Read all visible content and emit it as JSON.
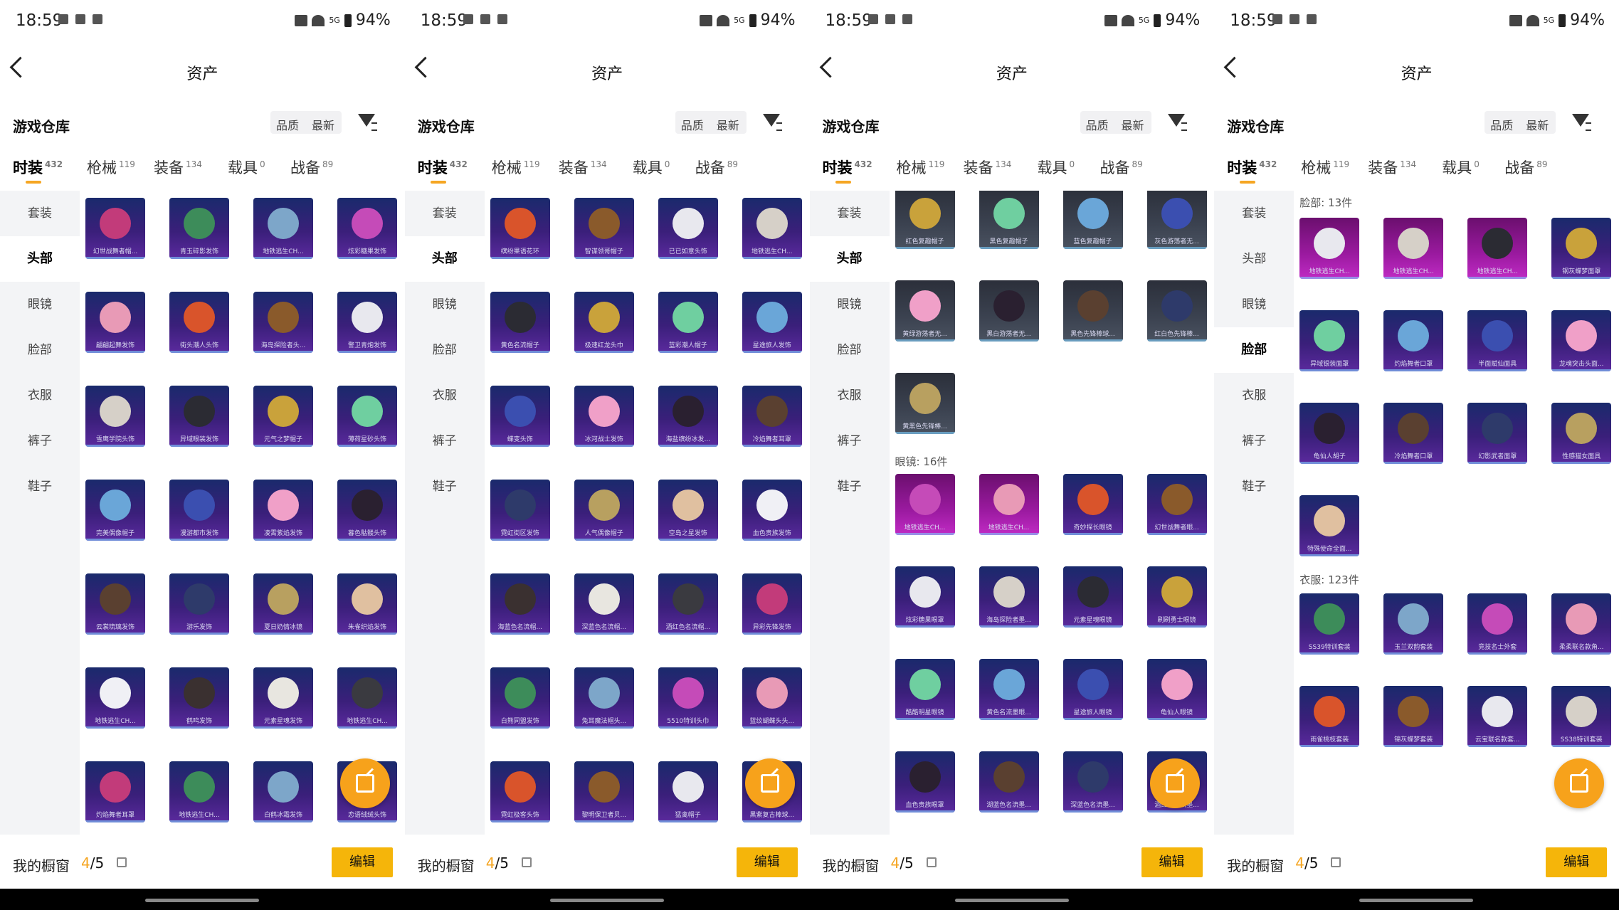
{
  "status": {
    "time": "18:59",
    "battery": "94%",
    "net": "5G"
  },
  "title": "资产",
  "warehouse": {
    "title": "游戏仓库",
    "sort_quality": "品质",
    "sort_latest": "最新"
  },
  "tabs": [
    {
      "label": "时装",
      "count": "432"
    },
    {
      "label": "枪械",
      "count": "119"
    },
    {
      "label": "装备",
      "count": "134"
    },
    {
      "label": "载具",
      "count": "0"
    },
    {
      "label": "战备",
      "count": "89"
    }
  ],
  "sidebar": [
    "套装",
    "头部",
    "眼镜",
    "脸部",
    "衣服",
    "裤子",
    "鞋子"
  ],
  "sections": {
    "face": "脸部: 13件",
    "glasses": "眼镜: 16件",
    "clothes": "衣服: 123件"
  },
  "bottom": {
    "label": "我的橱窗",
    "count": "4",
    "total": "/5",
    "edit": "编辑"
  },
  "screens": [
    {
      "active_sidebar": 1,
      "items": [
        "幻世战舞者帽...",
        "青玉碎影发饰",
        "地铁逃生CH...",
        "炫彩糖果发饰",
        "翩翩起舞发饰",
        "街头潮人头饰",
        "海岛探险者头...",
        "警卫青炮发饰",
        "雪鹰学院头饰",
        "异域眼装发饰",
        "元气之梦帽子",
        "薄荷星砂头饰",
        "完美偶像帽子",
        "漫游都市发饰",
        "凌霄紫焰发饰",
        "暮色骷髅头饰",
        "云裳琉璃发饰",
        "游乐发饰",
        "夏日奶情冰镜",
        "朱雀织焰发饰",
        "地铁逃生CH...",
        "鹤鸣发饰",
        "元素星魂发饰",
        "地铁逃生CH...",
        "灼焰舞者耳罩",
        "地铁逃生CH...",
        "白鹤冰霜发饰",
        "恋语绒绒头饰"
      ]
    },
    {
      "active_sidebar": 1,
      "items": [
        "缤纷果语花环",
        "智谋领哥帽子",
        "已已如意头饰",
        "地铁逃生CH...",
        "黄色名流帽子",
        "极速红龙头巾",
        "蓝彩潮人帽子",
        "星途旅人发饰",
        "蝶变头饰",
        "冰河战士发饰",
        "海盐缤纷冰发...",
        "冷焰舞者耳罩",
        "霓虹街区发饰",
        "人气偶像帽子",
        "空岛之星发饰",
        "血色贵族发饰",
        "海蓝色名流帽...",
        "深蓝色名流帽...",
        "酒红色名流帽...",
        "异彩先锋发饰",
        "白熊同盟发饰",
        "兔耳魔法帽头...",
        "5510特训头巾",
        "蓝纹蝴蝶头头...",
        "霓虹极客头饰",
        "黎明保卫者贝...",
        "猛禽帽子",
        "黑紫复古棒球..."
      ]
    },
    {
      "active_sidebar": 1,
      "items": [
        "红色复趣帽子",
        "黑色复趣帽子",
        "蓝色复趣帽子",
        "灰色游荡者无...",
        "黄绿游荡者无...",
        "黑白游荡者无...",
        "黑色先锋棒球...",
        "红白色先锋棒...",
        "黄黑色先锋棒..."
      ],
      "glasses": [
        "地铁逃生CH...",
        "地铁逃生CH...",
        "奇妙探长眼镜",
        "幻世战舞者眼...",
        "炫彩糖果眼罩",
        "海岛探险者墨...",
        "元素星魂眼镜",
        "刷刷勇士眼镜",
        "酷酷明星眼镜",
        "黄色名流墨眼...",
        "星途旅人眼镜",
        "龟仙人眼镜",
        "血色贵族眼罩",
        "湖蓝色名流墨...",
        "深蓝色名流墨...",
        "酒红色名流墨..."
      ]
    },
    {
      "active_sidebar": 3,
      "face": [
        "地铁逃生CH...",
        "地铁逃生CH...",
        "地铁逃生CH...",
        "钢灰蝶梦面罩",
        "异域银装面罩",
        "灼焰舞者口罩",
        "半面赋仙面具",
        "龙魂突击头面...",
        "龟仙人胡子",
        "冷焰舞者口罩",
        "幻影武者面罩",
        "性感猫女面具",
        "特殊使命全面..."
      ],
      "clothes": [
        "SS39特训套装",
        "玉兰双韵套装",
        "竞技名士外套",
        "柔柔联名款角...",
        "雨雀桃枝套装",
        "锦灰蝶梦套装",
        "云宝联名款套...",
        "SS38特训套装"
      ]
    }
  ]
}
